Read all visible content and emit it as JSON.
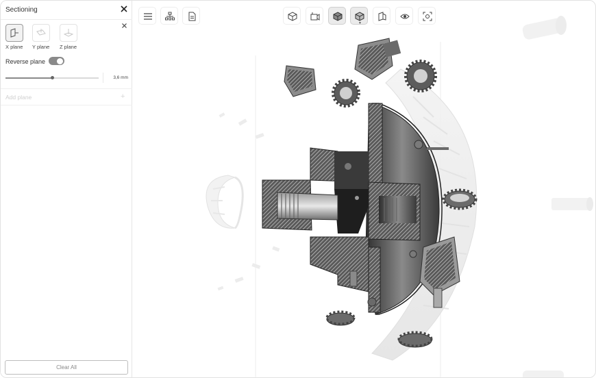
{
  "panel": {
    "title": "Sectioning",
    "planes": [
      {
        "label": "X plane",
        "active": true
      },
      {
        "label": "Y plane",
        "active": false
      },
      {
        "label": "Z plane",
        "active": false
      }
    ],
    "reverse_plane_label": "Reverse plane",
    "reverse_plane_on": true,
    "offset_value": "3,6 mm",
    "offset_fraction": 0.5,
    "add_plane_label": "Add plane",
    "clear_all_label": "Clear All"
  },
  "toolbar": {
    "left_icons": [
      "menu-icon",
      "assembly-tree-icon",
      "document-icon"
    ],
    "view_icons": [
      "standard-view-icon",
      "camera-view-icon",
      "shaded-view-icon",
      "display-mode-icon",
      "section-view-icon",
      "visibility-icon",
      "focus-view-icon"
    ]
  },
  "colors": {
    "accent": "#8a8a8a",
    "border": "#e2e2e2",
    "model_dark": "#3c3c3c"
  }
}
